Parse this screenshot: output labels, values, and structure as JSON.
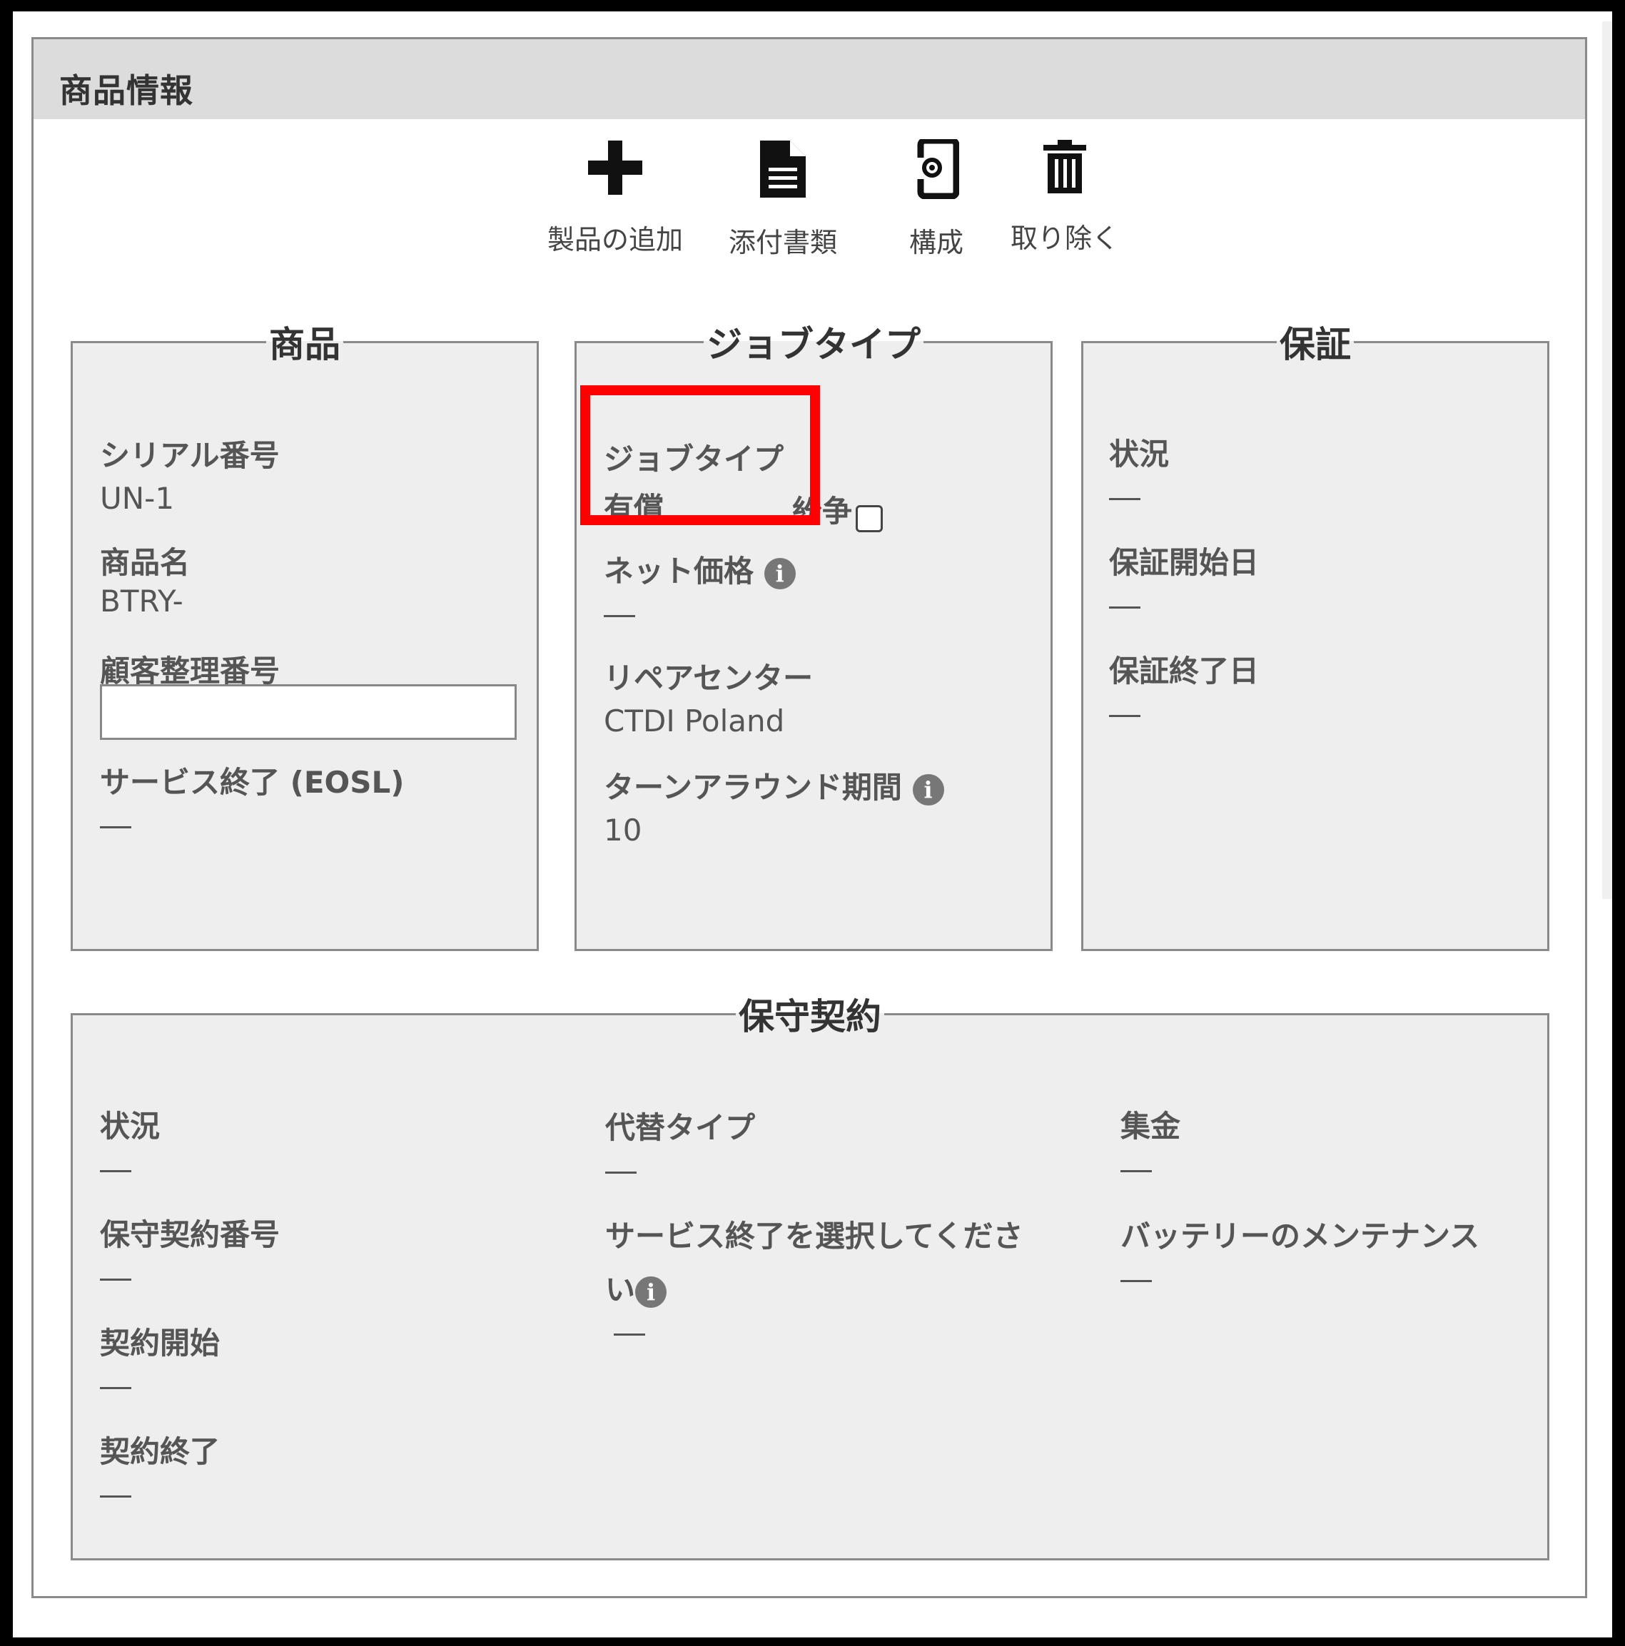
{
  "panel": {
    "title": "商品情報"
  },
  "toolbar": {
    "add_product": "製品の追加",
    "attachments": "添付書類",
    "configuration": "構成",
    "remove": "取り除く"
  },
  "product_box": {
    "legend": "商品",
    "serial_label": "シリアル番号",
    "serial_value": "UN-1",
    "name_label": "商品名",
    "name_value": "BTRY-",
    "customer_ref_label": "顧客整理番号",
    "customer_ref_value": "",
    "eosl_label": "サービス終了 (EOSL)"
  },
  "job_box": {
    "legend": "ジョブタイプ",
    "job_type_label": "ジョブタイプ",
    "job_type_value": "有償",
    "dispute_label": "紛争",
    "net_price_label": "ネット価格",
    "repair_center_label": "リペアセンター",
    "repair_center_value": "CTDI Poland",
    "turnaround_label": "ターンアラウンド期間",
    "turnaround_value": "10"
  },
  "warranty_box": {
    "legend": "保証",
    "status_label": "状況",
    "start_label": "保証開始日",
    "end_label": "保証終了日"
  },
  "contract_box": {
    "legend": "保守契約",
    "status_label": "状況",
    "number_label": "保守契約番号",
    "start_label": "契約開始",
    "end_label": "契約終了",
    "alt_type_label": "代替タイプ",
    "select_eos_label_line1": "サービス終了を選択してくださ",
    "select_eos_label_line2": "い",
    "collection_label": "集金",
    "battery_label": "バッテリーのメンテナンス"
  },
  "colors": {
    "highlight": "#ff0000",
    "box_bg": "#eeeeee",
    "header_bg": "#dcdcdc"
  },
  "icons": [
    "plus-icon",
    "document-icon",
    "config-device-icon",
    "trash-icon",
    "info-icon"
  ]
}
